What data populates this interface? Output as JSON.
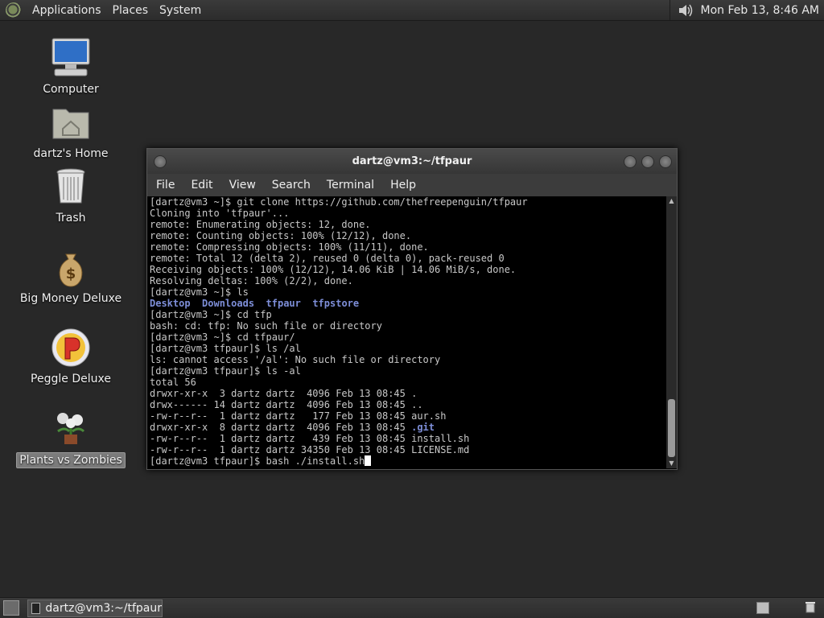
{
  "top_panel": {
    "menus": [
      "Applications",
      "Places",
      "System"
    ],
    "clock": "Mon Feb 13,  8:46 AM",
    "volume_icon": "speaker-icon"
  },
  "desktop_icons": [
    {
      "label": "Computer",
      "icon": "computer-icon"
    },
    {
      "label": "dartz's Home",
      "icon": "home-folder-icon"
    },
    {
      "label": "Trash",
      "icon": "trash-icon"
    },
    {
      "label": "Big Money Deluxe",
      "icon": "money-bag-icon"
    },
    {
      "label": "Peggle Deluxe",
      "icon": "peggle-icon"
    },
    {
      "label": "Plants vs Zombies",
      "icon": "plant-icon"
    }
  ],
  "terminal": {
    "title": "dartz@vm3:~/tfpaur",
    "menus": [
      "File",
      "Edit",
      "View",
      "Search",
      "Terminal",
      "Help"
    ],
    "lines": [
      "[dartz@vm3 ~]$ git clone https://github.com/thefreepenguin/tfpaur",
      "Cloning into 'tfpaur'...",
      "remote: Enumerating objects: 12, done.",
      "remote: Counting objects: 100% (12/12), done.",
      "remote: Compressing objects: 100% (11/11), done.",
      "remote: Total 12 (delta 2), reused 0 (delta 0), pack-reused 0",
      "Receiving objects: 100% (12/12), 14.06 KiB | 14.06 MiB/s, done.",
      "Resolving deltas: 100% (2/2), done.",
      "[dartz@vm3 ~]$ ls"
    ],
    "ls_dirs": [
      "Desktop",
      "Downloads",
      "tfpaur",
      "tfpstore"
    ],
    "lines2": [
      "[dartz@vm3 ~]$ cd tfp",
      "bash: cd: tfp: No such file or directory",
      "[dartz@vm3 ~]$ cd tfpaur/",
      "[dartz@vm3 tfpaur]$ ls /al",
      "ls: cannot access '/al': No such file or directory",
      "[dartz@vm3 tfpaur]$ ls -al",
      "total 56",
      "drwxr-xr-x  3 dartz dartz  4096 Feb 13 08:45 .",
      "drwx------ 14 dartz dartz  4096 Feb 13 08:45 ..",
      "-rw-r--r--  1 dartz dartz   177 Feb 13 08:45 aur.sh"
    ],
    "git_line_prefix": "drwxr-xr-x  8 dartz dartz  4096 Feb 13 08:45 ",
    "git_line_name": ".git",
    "lines3": [
      "-rw-r--r--  1 dartz dartz   439 Feb 13 08:45 install.sh",
      "-rw-r--r--  1 dartz dartz 34350 Feb 13 08:45 LICENSE.md"
    ],
    "prompt_line": "[dartz@vm3 tfpaur]$ bash ./install.sh"
  },
  "bottom_panel": {
    "task_label": "dartz@vm3:~/tfpaur"
  }
}
